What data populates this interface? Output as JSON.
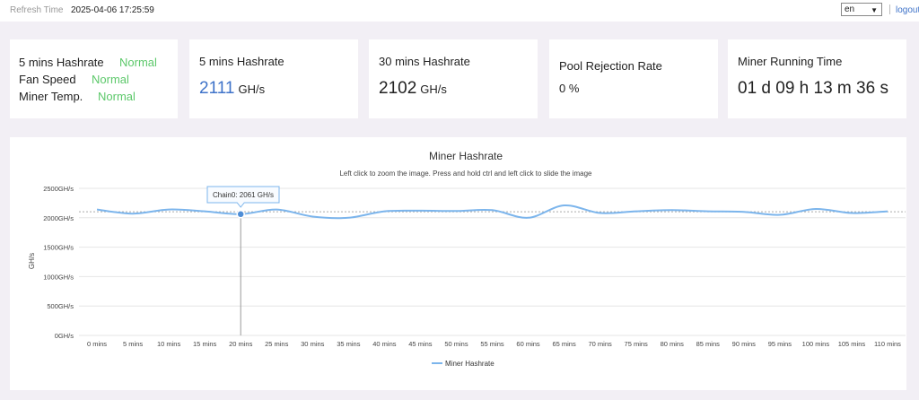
{
  "header": {
    "refresh_label": "Refresh Time",
    "refresh_value": "2025-04-06 17:25:59",
    "language": "en",
    "logout_label": "logout"
  },
  "status_card": {
    "rows": [
      {
        "label": "5 mins Hashrate",
        "value": "Normal"
      },
      {
        "label": "Fan Speed",
        "value": "Normal"
      },
      {
        "label": "Miner Temp.",
        "value": "Normal"
      }
    ],
    "ok_color": "#5cc86a"
  },
  "cards": {
    "hash5": {
      "title": "5 mins Hashrate",
      "value": "2111",
      "unit": "GH/s",
      "value_color": "#3f73c9"
    },
    "hash30": {
      "title": "30 mins Hashrate",
      "value": "2102",
      "unit": "GH/s"
    },
    "rejection": {
      "title": "Pool Rejection Rate",
      "value": "0 %"
    },
    "runtime": {
      "title": "Miner Running Time",
      "value": "01 d 09 h 13 m 36 s"
    }
  },
  "chart_data": {
    "type": "line",
    "title": "Miner Hashrate",
    "subtitle": "Left click to zoom the image. Press and hold ctrl and left click to slide the image",
    "ylabel": "GH/s",
    "ylim": [
      0,
      2500
    ],
    "yticks": [
      0,
      500,
      1000,
      1500,
      2000,
      2500
    ],
    "ytick_labels": [
      "0GH/s",
      "500GH/s",
      "1000GH/s",
      "1500GH/s",
      "2000GH/s",
      "2500GH/s"
    ],
    "categories": [
      "0 mins",
      "5 mins",
      "10 mins",
      "15 mins",
      "20 mins",
      "25 mins",
      "30 mins",
      "35 mins",
      "40 mins",
      "45 mins",
      "50 mins",
      "55 mins",
      "60 mins",
      "65 mins",
      "70 mins",
      "75 mins",
      "80 mins",
      "85 mins",
      "90 mins",
      "95 mins",
      "100 mins",
      "105 mins",
      "110 mins"
    ],
    "series": [
      {
        "name": "Miner Hashrate",
        "color": "#7cb5ec",
        "values": [
          2140,
          2070,
          2140,
          2110,
          2061,
          2140,
          2020,
          2000,
          2110,
          2120,
          2115,
          2130,
          2000,
          2210,
          2080,
          2110,
          2130,
          2110,
          2100,
          2050,
          2150,
          2080,
          2110
        ]
      }
    ],
    "average_line": 2102,
    "tooltip": {
      "text": "Chain0: 2061 GH/s",
      "index": 4
    },
    "legend": "bottom-center",
    "grid": true
  }
}
